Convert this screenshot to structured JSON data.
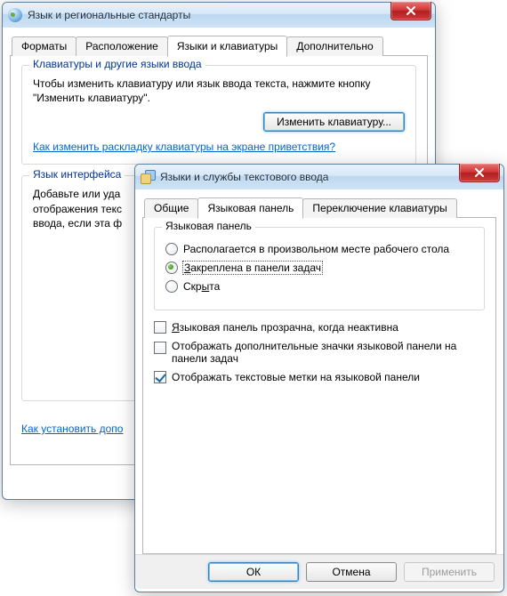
{
  "region_window": {
    "title": "Язык и региональные стандарты",
    "tabs": [
      "Форматы",
      "Расположение",
      "Языки и клавиатуры",
      "Дополнительно"
    ],
    "active_tab": 2,
    "group1": {
      "legend": "Клавиатуры и другие языки ввода",
      "text": "Чтобы изменить клавиатуру или язык ввода текста, нажмите кнопку \"Изменить клавиатуру\".",
      "button": "Изменить клавиатуру...",
      "link": "Как изменить раскладку клавиатуры на экране приветствия?"
    },
    "group2": {
      "legend": "Язык интерфейса",
      "text_partial": "Добавьте или уда\nотображения текс\nввода, если эта ф"
    },
    "bottom_link": "Как установить допо"
  },
  "text_window": {
    "title": "Языки и службы текстового ввода",
    "tabs": [
      "Общие",
      "Языковая панель",
      "Переключение клавиатуры"
    ],
    "active_tab": 1,
    "group": {
      "legend": "Языковая панель",
      "radios": [
        {
          "label": "Располагается в произвольном месте рабочего стола",
          "checked": false,
          "accel_index": null
        },
        {
          "label": "Закреплена в панели задач",
          "checked": true,
          "accel_index": 0
        },
        {
          "label": "Скрыта",
          "checked": false,
          "accel_index": 3
        }
      ]
    },
    "checks": [
      {
        "label": "Языковая панель прозрачна, когда неактивна",
        "checked": false,
        "accel_index": 0
      },
      {
        "label": "Отображать дополнительные значки языковой панели на панели задач",
        "checked": false,
        "accel_index": null
      },
      {
        "label": "Отображать текстовые метки на языковой панели",
        "checked": true,
        "accel_index": null
      }
    ],
    "buttons": {
      "ok": "ОК",
      "cancel": "Отмена",
      "apply": "Применить"
    }
  }
}
